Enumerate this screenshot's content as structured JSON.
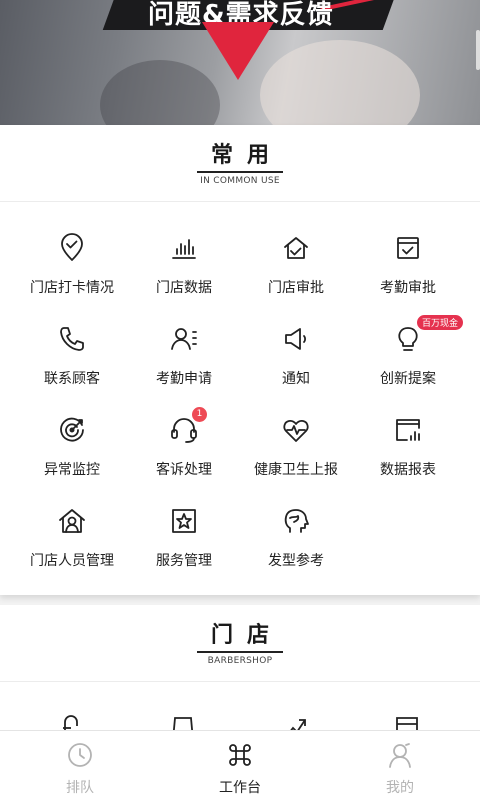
{
  "banner": {
    "title": "问题&需求反馈"
  },
  "common": {
    "title": "常用",
    "subtitle": "IN COMMON USE",
    "items": [
      {
        "label": "门店打卡情况",
        "icon": "checkin-location-icon"
      },
      {
        "label": "门店数据",
        "icon": "bar-chart-icon"
      },
      {
        "label": "门店审批",
        "icon": "store-approve-icon"
      },
      {
        "label": "考勤审批",
        "icon": "attendance-approve-icon"
      },
      {
        "label": "联系顾客",
        "icon": "phone-icon"
      },
      {
        "label": "考勤申请",
        "icon": "user-list-icon"
      },
      {
        "label": "通知",
        "icon": "speaker-icon"
      },
      {
        "label": "创新提案",
        "icon": "lightbulb-icon",
        "badge": "百万现金"
      },
      {
        "label": "异常监控",
        "icon": "target-icon"
      },
      {
        "label": "客诉处理",
        "icon": "headset-icon",
        "badge_count": "1"
      },
      {
        "label": "健康卫生上报",
        "icon": "heart-pulse-icon"
      },
      {
        "label": "数据报表",
        "icon": "report-chart-icon"
      },
      {
        "label": "门店人员管理",
        "icon": "home-user-icon"
      },
      {
        "label": "服务管理",
        "icon": "star-frame-icon"
      },
      {
        "label": "发型参考",
        "icon": "hair-head-icon"
      }
    ]
  },
  "store": {
    "title": "门店",
    "subtitle": "BARBERSHOP"
  },
  "tabbar": {
    "items": [
      {
        "label": "排队",
        "icon": "clock-icon",
        "active": false
      },
      {
        "label": "工作台",
        "icon": "command-icon",
        "active": true
      },
      {
        "label": "我的",
        "icon": "user-icon",
        "active": false
      }
    ]
  },
  "colors": {
    "accent": "#e0253d",
    "badge": "#e5324f",
    "inactive": "#b3b3b3"
  }
}
